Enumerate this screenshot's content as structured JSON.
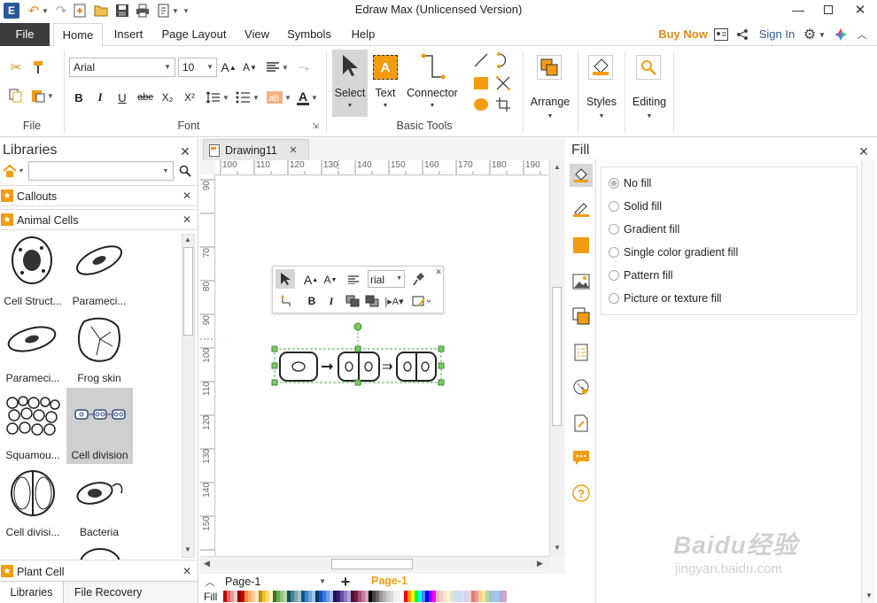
{
  "app": {
    "title": "Edraw Max (Unlicensed Version)"
  },
  "menu": {
    "file": "File",
    "tabs": [
      "Home",
      "Insert",
      "Page Layout",
      "View",
      "Symbols",
      "Help"
    ],
    "buy_now": "Buy Now",
    "sign_in": "Sign In"
  },
  "ribbon": {
    "file_group": "File",
    "font_group": "Font",
    "font_name": "Arial",
    "font_size": "10",
    "basic_tools_group": "Basic Tools",
    "select": "Select",
    "text": "Text",
    "connector": "Connector",
    "arrange": "Arrange",
    "styles": "Styles",
    "editing": "Editing",
    "bold": "B",
    "italic": "I",
    "underline": "U",
    "strike": "abc",
    "subscript": "X₂",
    "superscript": "X²",
    "grow": "A",
    "shrink": "A",
    "fontcolor": "A"
  },
  "libraries": {
    "title": "Libraries",
    "search_value": "",
    "sections": [
      "Callouts",
      "Animal Cells",
      "Plant Cell"
    ],
    "items": [
      "Cell Struct...",
      "Parameci...",
      "Parameci...",
      "Frog skin",
      "Squamou...",
      "Cell division",
      "Cell divisi...",
      "Bacteria"
    ],
    "bottom_tabs": [
      "Libraries",
      "File Recovery"
    ]
  },
  "document": {
    "tab": "Drawing11",
    "ruler_h": [
      "100",
      "110",
      "120",
      "130",
      "140",
      "150",
      "160",
      "170",
      "180",
      "190"
    ],
    "ruler_v": [
      "90",
      "70",
      "80",
      "90",
      "100",
      "110",
      "120",
      "130",
      "140",
      "150"
    ],
    "page_select": "Page-1",
    "page_tab": "Page-1",
    "fill_label": "Fill"
  },
  "mini_toolbar": {
    "font_value": "rial",
    "bold": "B",
    "italic": "I"
  },
  "fill_panel": {
    "title": "Fill",
    "options": [
      "No fill",
      "Solid fill",
      "Gradient fill",
      "Single color gradient fill",
      "Pattern fill",
      "Picture or texture fill"
    ],
    "selected": "No fill"
  },
  "watermark": {
    "line1": "Baidu经验",
    "line2": "jingyan.baidu.com"
  },
  "colors": {
    "accent": "#f39c12",
    "blue": "#2b579a",
    "file": "#3c3c3c",
    "select_bg": "#d6d6d6"
  },
  "palette": [
    "#c00000",
    "#e06666",
    "#ea9999",
    "#f4cccc",
    "#990000",
    "#cc0000",
    "#e69138",
    "#f6b26b",
    "#f9cb9c",
    "#fce5cd",
    "#bf9000",
    "#f1c232",
    "#ffd966",
    "#fff2cc",
    "#38761d",
    "#6aa84f",
    "#93c47d",
    "#b6d7a8",
    "#134f5c",
    "#45818e",
    "#76a5af",
    "#a2c4c9",
    "#0b5394",
    "#3d85c6",
    "#6fa8dc",
    "#9fc5e8",
    "#073763",
    "#1155cc",
    "#3c78d8",
    "#6d9eeb",
    "#a4c2f4",
    "#20124d",
    "#351c75",
    "#674ea7",
    "#8e7cc3",
    "#b4a7d6",
    "#4c1130",
    "#741b47",
    "#a64d79",
    "#c27ba0",
    "#d5a6bd",
    "#000000",
    "#434343",
    "#666666",
    "#999999",
    "#b7b7b7",
    "#cccccc",
    "#d9d9d9",
    "#efefef",
    "#f3f3f3",
    "#ffffff",
    "#ff0000",
    "#ff9900",
    "#ffff00",
    "#00ff00",
    "#00ffff",
    "#4a86e8",
    "#0000ff",
    "#9900ff",
    "#ff00ff",
    "#e6b8af",
    "#f4cccc",
    "#fce5cd",
    "#fff2cc",
    "#d9ead3",
    "#d0e0e3",
    "#c9daf8",
    "#cfe2f3",
    "#d9d2e9",
    "#ead1dc",
    "#dd7e6b",
    "#ea9999",
    "#f9cb9c",
    "#ffe599",
    "#b6d7a8",
    "#a2c4c9",
    "#a4c2f4",
    "#9fc5e8",
    "#b4a7d6",
    "#d5a6bd"
  ]
}
